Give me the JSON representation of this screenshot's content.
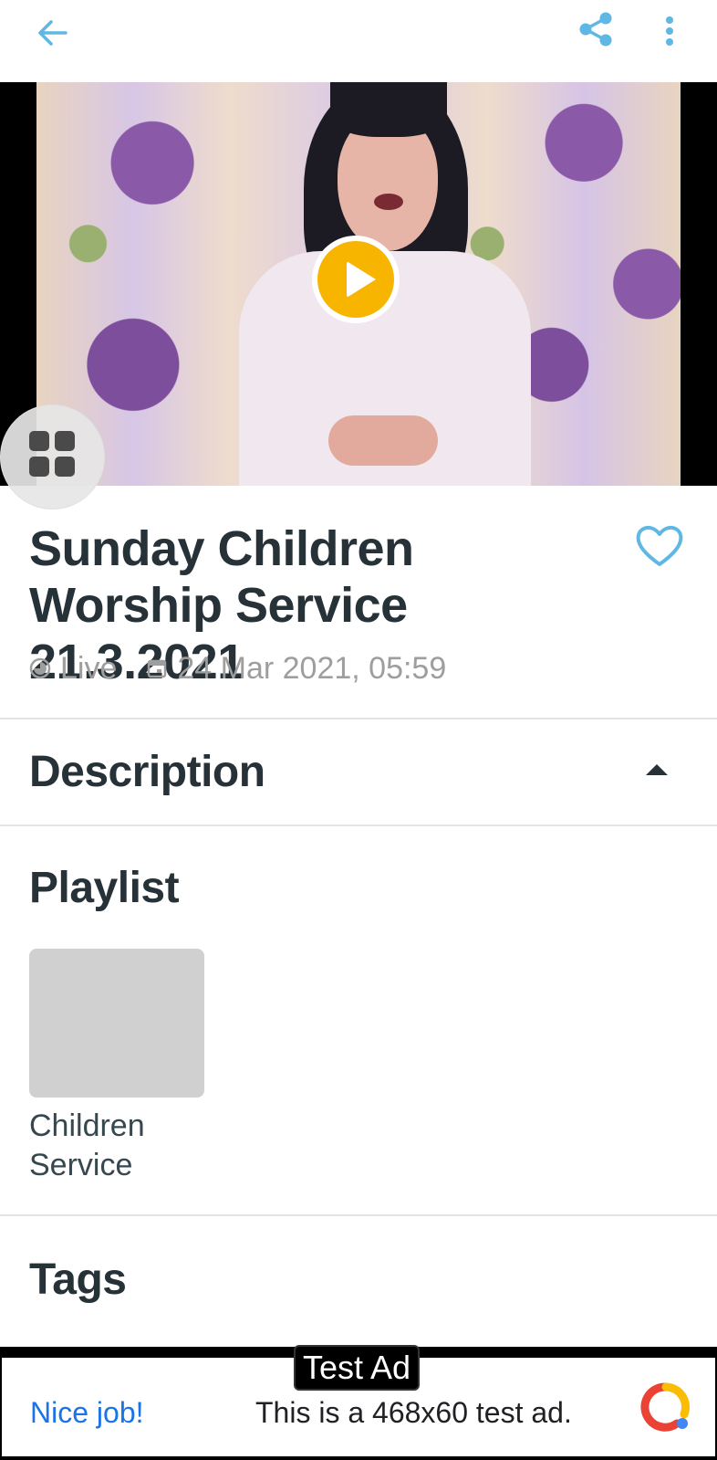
{
  "toolbar": {
    "back_icon": "arrow-left-icon",
    "share_icon": "share-icon",
    "more_icon": "more-vertical-icon",
    "accent_color": "#5fb7e4"
  },
  "player": {
    "play_icon": "play-icon",
    "play_color": "#f7b500"
  },
  "floating_menu": {
    "icon": "grid-icon"
  },
  "video": {
    "title": "Sunday Children Worship Service 21.3.2021",
    "favorite_icon": "heart-outline-icon",
    "status_label": "Live",
    "status_icon": "clock-icon",
    "date_icon": "calendar-icon",
    "date": "24 Mar 2021, 05:59"
  },
  "description": {
    "heading": "Description",
    "toggle_icon": "caret-up-icon"
  },
  "playlist": {
    "heading": "Playlist",
    "items": [
      {
        "label": "Children Service"
      }
    ]
  },
  "tags": {
    "heading": "Tags"
  },
  "ad": {
    "badge": "Test Ad",
    "headline": "Nice job!",
    "body": "This is a 468x60 test ad.",
    "logo_icon": "admob-logo-icon"
  }
}
